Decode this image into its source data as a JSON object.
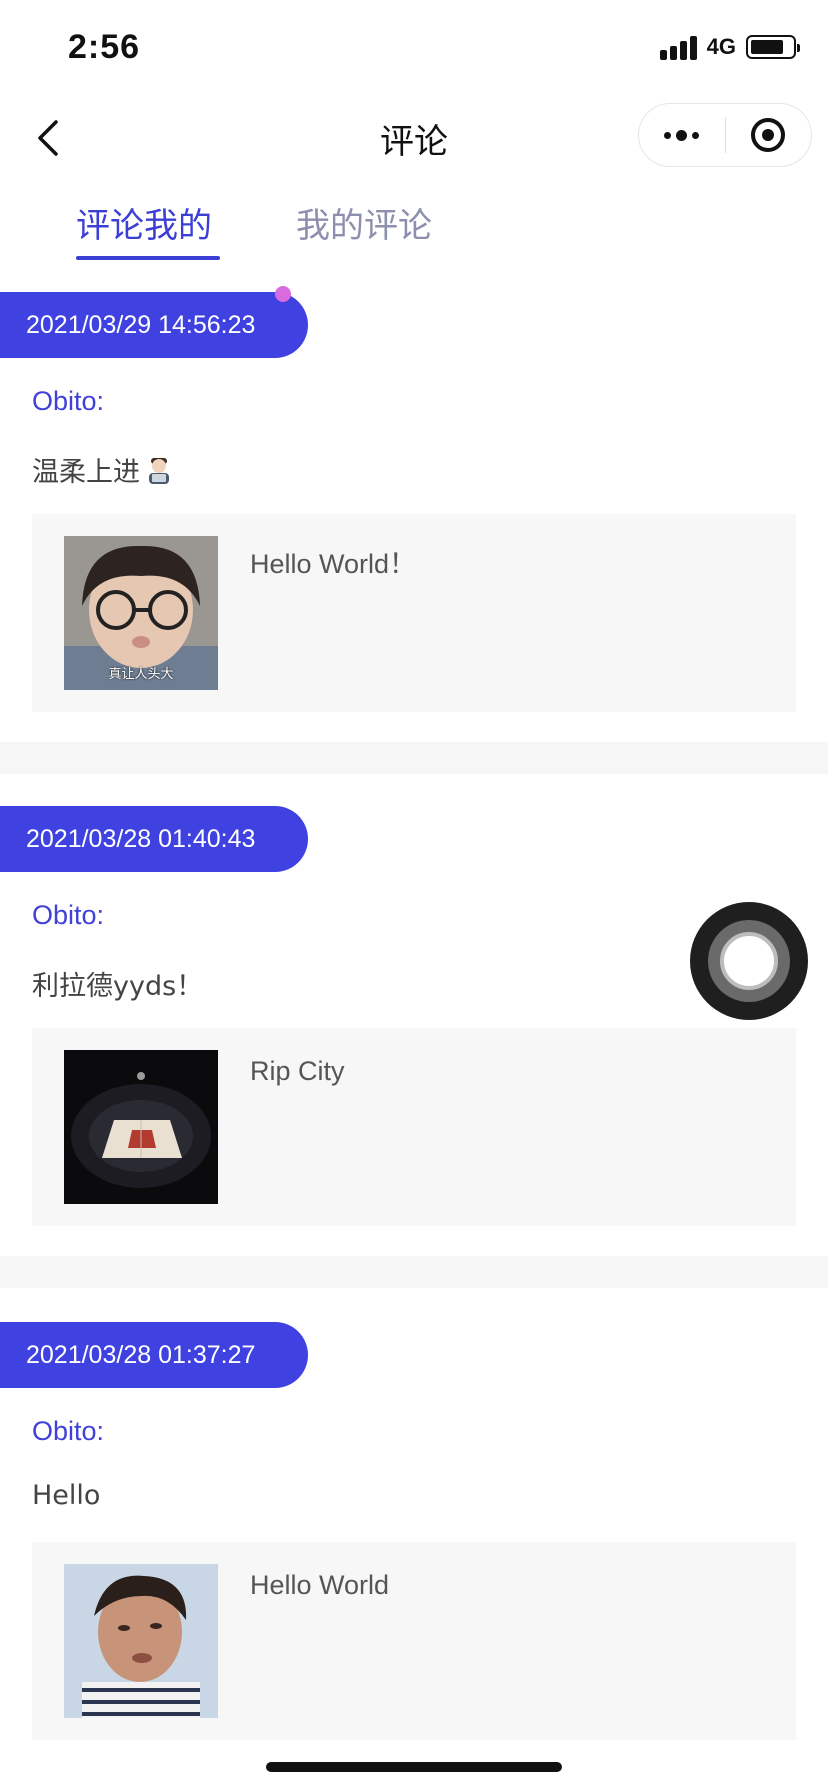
{
  "status_bar": {
    "time": "2:56",
    "network": "4G",
    "battery_level": 0.8
  },
  "nav": {
    "title": "评论",
    "back_icon": "chevron-left-icon",
    "more_icon": "more-dots-icon",
    "close_icon": "target-icon"
  },
  "tabs": [
    {
      "label": "评论我的",
      "active": true
    },
    {
      "label": "我的评论",
      "active": false
    }
  ],
  "comments": [
    {
      "date": "2021/03/29 14:56:23",
      "unread": true,
      "author": "Obito:",
      "text": "温柔上进",
      "emoji": "technologist-emoji-icon",
      "quote": {
        "thumbnail": "child-with-glasses-photo",
        "thumbnail_caption": "真让人头大",
        "text": "Hello World！"
      }
    },
    {
      "date": "2021/03/28 01:40:43",
      "unread": false,
      "author": "Obito:",
      "text": "利拉德yyds！",
      "emoji": "",
      "quote": {
        "thumbnail": "basketball-arena-photo",
        "thumbnail_caption": "",
        "text": "Rip City"
      }
    },
    {
      "date": "2021/03/28 01:37:27",
      "unread": false,
      "author": "Obito:",
      "text": "Hello",
      "emoji": "",
      "quote": {
        "thumbnail": "blurry-face-photo",
        "thumbnail_caption": "",
        "text": "Hello World"
      }
    }
  ],
  "floating_button": {
    "icon": "assistive-touch-icon"
  },
  "colors": {
    "accent": "#3f41e0",
    "tab_inactive": "#8c8fad",
    "unread_dot": "#d86bde",
    "quote_bg": "#f7f7f7"
  }
}
